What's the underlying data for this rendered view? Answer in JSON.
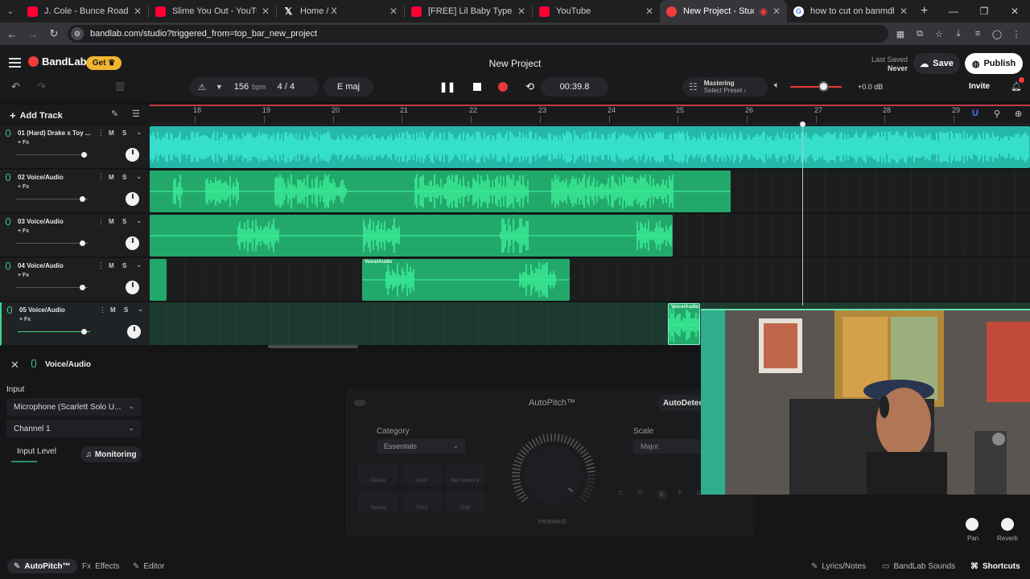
{
  "browser": {
    "tabs": [
      {
        "title": "J. Cole - Bunce Road Blues [Inst",
        "icon": "youtube-icon"
      },
      {
        "title": "Slime You Out - YouTube",
        "icon": "youtube-icon"
      },
      {
        "title": "Home / X",
        "icon": "x-icon"
      },
      {
        "title": "[FREE] Lil Baby Type Beat - \"Ne",
        "icon": "youtube-icon"
      },
      {
        "title": "YouTube",
        "icon": "youtube-icon"
      },
      {
        "title": "New Project - Studio",
        "icon": "bandlab-icon",
        "active": true
      },
      {
        "title": "how to cut on banmdlab - Goo",
        "icon": "google-icon"
      }
    ],
    "url": "bandlab.com/studio?triggered_from=top_bar_new_project"
  },
  "header": {
    "brand": "BandLab",
    "get_label": "Get",
    "project_title": "New Project",
    "last_saved_label": "Last Saved",
    "last_saved_value": "Never",
    "save_label": "Save",
    "publish_label": "Publish",
    "bpm_value": "156",
    "bpm_unit": "bpm",
    "time_signature": "4 / 4",
    "key": "E maj",
    "time": "00:39.8",
    "mastering_title": "Mastering",
    "mastering_preset": "Select Preset",
    "volume_db": "+0.0 dB",
    "invite_label": "Invite"
  },
  "tracks_toolbar": {
    "add_track_label": "Add Track"
  },
  "ruler": {
    "bars": [
      "18",
      "19",
      "20",
      "21",
      "22",
      "23",
      "24",
      "25",
      "26",
      "27",
      "28",
      "29"
    ]
  },
  "tracks": [
    {
      "name": "01 (Hard) Drake x Toy ...",
      "fx": "+ Fx",
      "m": "M",
      "s": "S",
      "fader": 0.92
    },
    {
      "name": "02 Voice/Audio",
      "fx": "+ Fx",
      "m": "M",
      "s": "S",
      "fader": 0.9
    },
    {
      "name": "03 Voice/Audio",
      "fx": "+ Fx",
      "m": "M",
      "s": "S",
      "fader": 0.9
    },
    {
      "name": "04 Voice/Audio",
      "fx": "+ Fx",
      "m": "M",
      "s": "S",
      "fader": 0.9
    },
    {
      "name": "05 Voice/Audio",
      "fx": "+ Fx",
      "m": "M",
      "s": "S",
      "fader": 0.9
    }
  ],
  "clips": {
    "clip_label": "Voice/Audio"
  },
  "panel": {
    "title": "Voice/Audio",
    "input_label": "Input",
    "input_device": "Microphone (Scarlett Solo U...",
    "channel": "Channel 1",
    "input_level_label": "Input Level",
    "monitoring_label": "Monitoring",
    "autopitch": {
      "title": "AutoPitch™",
      "autodetect_label": "AutoDetect",
      "category_label": "Category",
      "category_value": "Essentials",
      "scale_label": "Scale",
      "scale_value": "Major",
      "presets": [
        "Classic",
        "Duet",
        "Big Harmony",
        "Natural",
        "Third",
        "Chip"
      ],
      "dial_label": "Heaviest",
      "notes": [
        "C",
        "D",
        "E",
        "F",
        "G",
        "A",
        "B"
      ]
    },
    "pan_label": "Pan",
    "reverb_label": "Reverb"
  },
  "bottom_bar": {
    "autopitch": "AutoPitch™",
    "effects": "Effects",
    "editor": "Editor",
    "lyrics": "Lyrics/Notes",
    "sounds": "BandLab Sounds",
    "shortcuts": "Shortcuts"
  },
  "colors": {
    "accent": "#f23b3b",
    "clip_green": "#23a86b",
    "clip_teal": "#25b8a8",
    "get_yellow": "#f2b530"
  }
}
